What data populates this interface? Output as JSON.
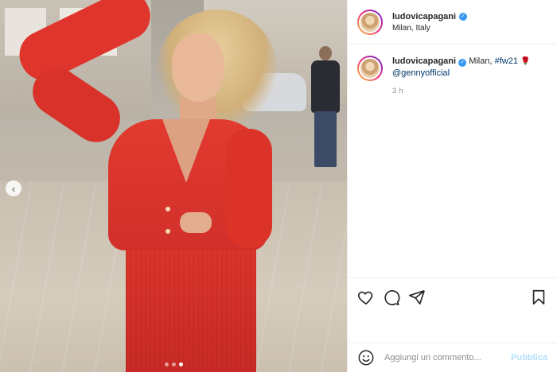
{
  "post": {
    "username": "ludovicapagani",
    "location": "Milan, Italy",
    "caption": {
      "username": "ludovicapagani",
      "text_1": "Milan,",
      "hashtag": "#fw21",
      "rose": "🌹",
      "mention": "@gennyofficial"
    },
    "time_ago": "3 h"
  },
  "carousel": {
    "prev_icon": "‹",
    "dots_count": 3,
    "active_dot": 3
  },
  "comment_bar": {
    "placeholder": "Aggiungi un commento...",
    "publish_label": "Pubblica"
  },
  "icons": {
    "like": "heart-icon",
    "comment": "comment-icon",
    "share": "paper-plane-icon",
    "save": "bookmark-icon",
    "emoji": "smiley-icon",
    "verified": "verified-badge-icon"
  },
  "colors": {
    "link": "#00376b",
    "verified": "#3897f0",
    "publish_disabled": "#b2dffc",
    "meta": "#8e8e8e"
  }
}
